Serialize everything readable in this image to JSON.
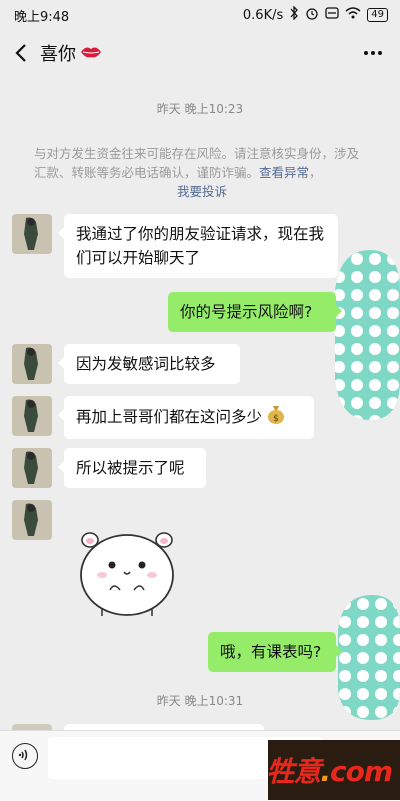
{
  "status_bar": {
    "time": "晚上9:48",
    "speed": "0.6K/s",
    "battery": "49"
  },
  "header": {
    "contact_name": "喜你",
    "back_icon": "chevron-left-icon",
    "more_icon": "more-dots-icon"
  },
  "timestamps": [
    "昨天 晚上10:23",
    "昨天 晚上10:31"
  ],
  "notice": {
    "text": "与对方发生资金往来可能存在风险。请注意核实身份，涉及汇款、转账等务必电话确认，谨防诈骗。",
    "link1": "查看异常",
    "sep": "，",
    "link2": "我要投诉"
  },
  "messages": [
    {
      "side": "in",
      "text": "我通过了你的朋友验证请求，现在我们可以开始聊天了"
    },
    {
      "side": "out",
      "text": "你的号提示风险啊?"
    },
    {
      "side": "in",
      "text": "因为发敏感词比较多"
    },
    {
      "side": "in",
      "text": "再加上哥哥们都在这问多少",
      "emoji": "money-bag-icon"
    },
    {
      "side": "in",
      "text": "所以被提示了呢"
    },
    {
      "side": "in",
      "sticker": "hamster-sticker"
    },
    {
      "side": "out",
      "text": "哦，有课表吗?"
    }
  ],
  "watermark": {
    "text": "牲意",
    "dot": ".",
    "com": "com"
  },
  "colors": {
    "outgoing_bubble": "#95ec69",
    "incoming_bubble": "#ffffff",
    "background": "#ededed",
    "link": "#576b95"
  }
}
